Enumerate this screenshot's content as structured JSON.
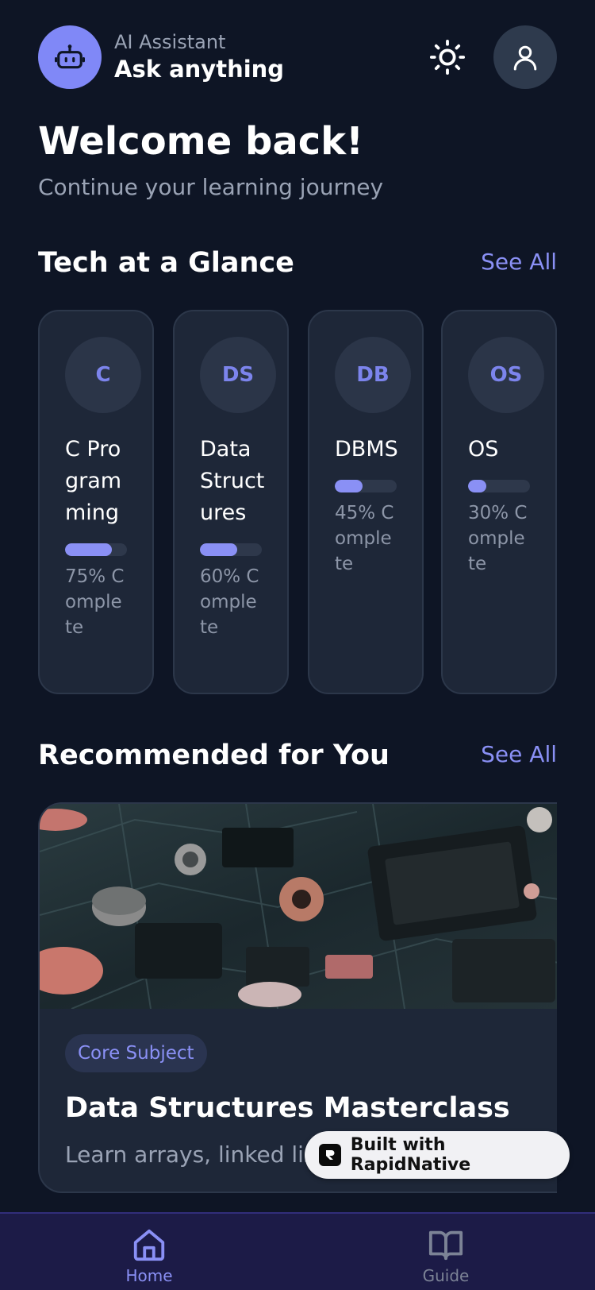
{
  "header": {
    "subtitle": "AI Assistant",
    "title": "Ask anything",
    "bot_icon": "robot-icon",
    "theme_icon": "sun-icon",
    "profile_icon": "user-icon"
  },
  "welcome": {
    "title": "Welcome back!",
    "subtitle": "Continue your learning journey"
  },
  "tech_section": {
    "title": "Tech at a Glance",
    "see_all": "See All",
    "items": [
      {
        "badge": "C",
        "name": "C Programming",
        "progress": 75,
        "progress_text": "75% Complete"
      },
      {
        "badge": "DS",
        "name": "Data Structures",
        "progress": 60,
        "progress_text": "60% Complete"
      },
      {
        "badge": "DB",
        "name": "DBMS",
        "progress": 45,
        "progress_text": "45% Complete"
      },
      {
        "badge": "OS",
        "name": "OS",
        "progress": 30,
        "progress_text": "30% Complete"
      }
    ]
  },
  "recommended": {
    "title": "Recommended for You",
    "see_all": "See All",
    "card": {
      "tag": "Core Subject",
      "title": "Data Structures Masterclass",
      "description": "Learn arrays, linked lists"
    }
  },
  "badge": {
    "text": "Built with RapidNative"
  },
  "nav": {
    "items": [
      {
        "label": "Home",
        "icon": "home-icon",
        "active": true
      },
      {
        "label": "Guide",
        "icon": "book-icon",
        "active": false
      }
    ]
  },
  "colors": {
    "background": "#0e1525",
    "card": "#1e2738",
    "accent": "#8a90f5",
    "nav_background": "#1c1b47"
  }
}
